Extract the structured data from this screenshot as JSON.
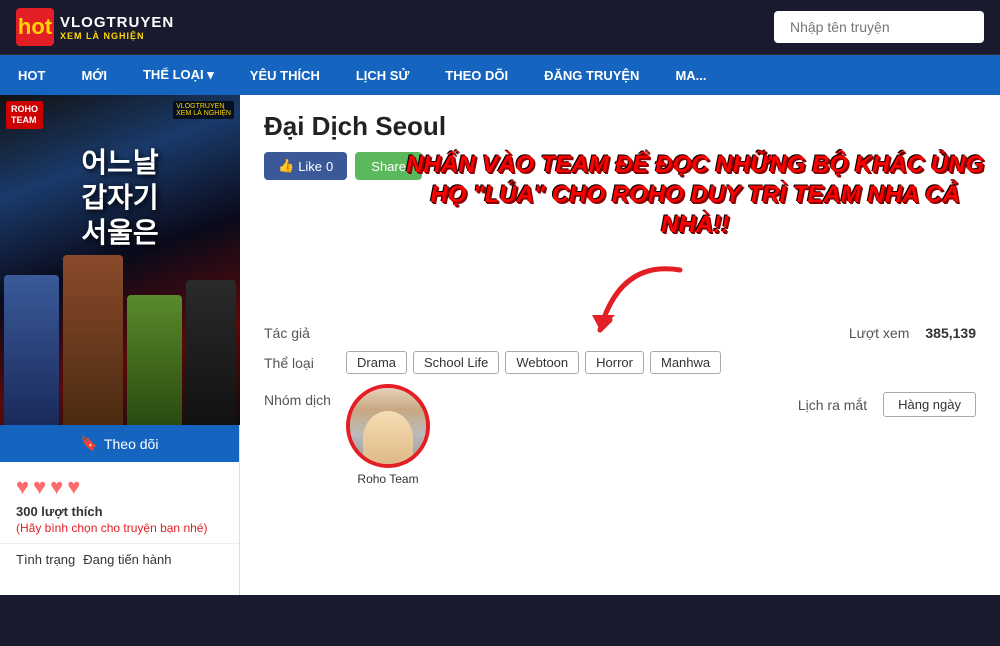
{
  "header": {
    "logo_title": "VLOGTRUYEN",
    "logo_subtitle": "XEM LÀ NGHIỆN",
    "logo_v": "V",
    "search_placeholder": "Nhập tên truyện"
  },
  "nav": {
    "items": [
      {
        "label": "HOT",
        "id": "hot"
      },
      {
        "label": "MỚI",
        "id": "moi"
      },
      {
        "label": "THỂ LOẠI ▾",
        "id": "the-loai"
      },
      {
        "label": "YÊU THÍCH",
        "id": "yeu-thich"
      },
      {
        "label": "LỊCH SỬ",
        "id": "lich-su"
      },
      {
        "label": "THEO DÕI",
        "id": "theo-doi"
      },
      {
        "label": "ĐĂNG TRUYỆN",
        "id": "dang-truyen"
      },
      {
        "label": "MA...",
        "id": "ma"
      }
    ]
  },
  "manga": {
    "title": "Đại Dịch Seoul",
    "cover_text_line1": "어느날",
    "cover_text_line2": "갑자기",
    "cover_text_line3": "서울은",
    "roho_badge": "ROHO\nTEAM",
    "promo_text_line1": "NHẤN VÀO TEAM ĐỂ ĐỌC NHỮNG BỘ KHÁC ỦNG",
    "promo_text_line2": "HỌ \"LÚA\" CHO ROHO DUY TRÌ TEAM NHA CẢ NHÀ!!",
    "like_label": "Like",
    "like_count": "0",
    "share_label": "Share",
    "tac_gia_label": "Tác giả",
    "tac_gia_value": "",
    "luot_xem_label": "Lượt xem",
    "luot_xem_value": "385,139",
    "the_loai_label": "Thể loại",
    "tags": [
      "Drama",
      "School Life",
      "Webtoon",
      "Horror",
      "Manhwa"
    ],
    "nhom_dich_label": "Nhóm dịch",
    "group_name": "Roho Team",
    "lich_ra_mat_label": "Lịch ra mắt",
    "lich_ra_mat_value": "Hàng ngày",
    "follow_label": "Theo dõi",
    "hearts": [
      "♥",
      "♥",
      "♥",
      "♥"
    ],
    "likes_count": "300 lượt thích",
    "likes_hint": "(Hãy bình chọn cho truyện bạn nhé)",
    "tinh_trang_label": "Tình trạng",
    "tinh_trang_value": "Đang tiến hành"
  }
}
